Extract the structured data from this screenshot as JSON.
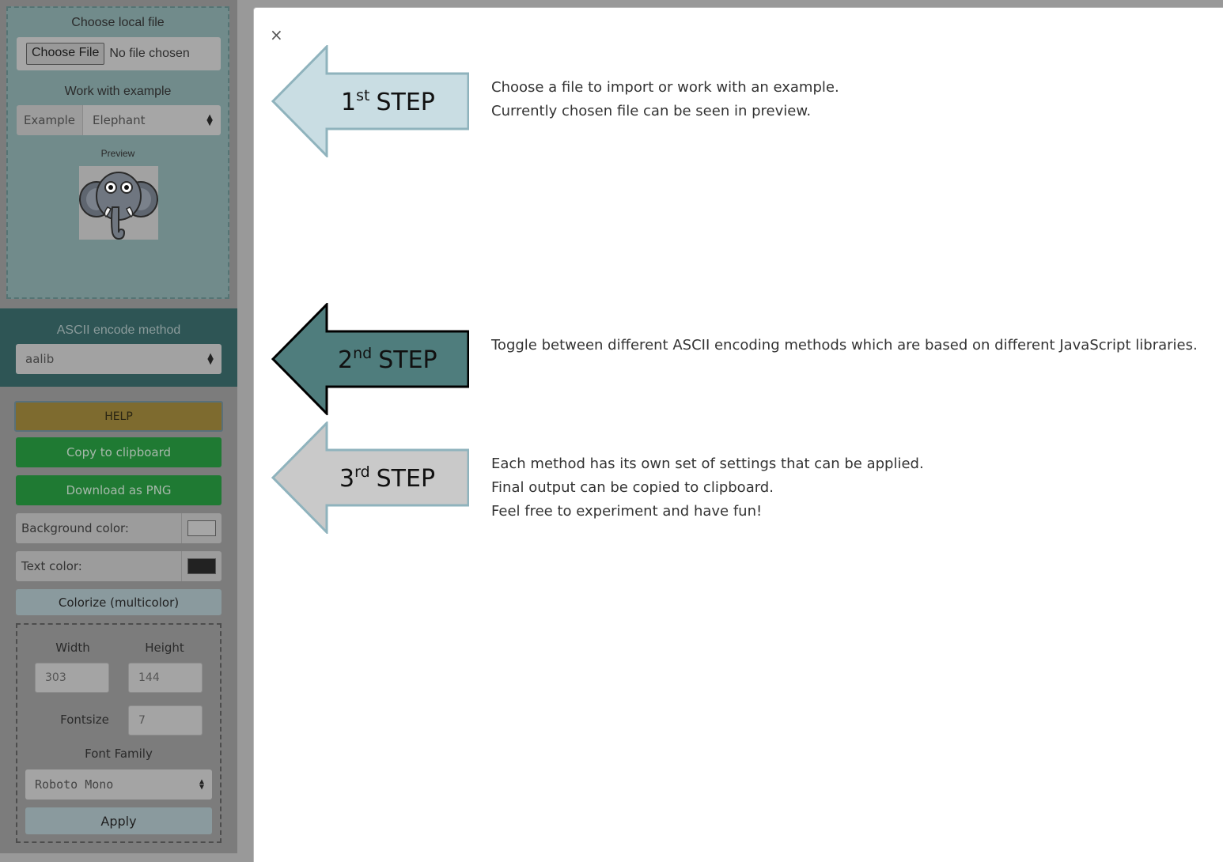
{
  "sidebar": {
    "file_section": {
      "choose_local_label": "Choose local file",
      "choose_button": "Choose File",
      "no_file_text": "No file chosen",
      "work_example_label": "Work with example",
      "example_addon": "Example",
      "example_value": "Elephant",
      "preview_label": "Preview"
    },
    "encode": {
      "label": "ASCII encode method",
      "value": "aalib"
    },
    "buttons": {
      "help": "HELP",
      "copy": "Copy to clipboard",
      "download": "Download as PNG",
      "colorize": "Colorize (multicolor)"
    },
    "colors": {
      "background_label": "Background color:",
      "background_value": "#a6a6a6",
      "text_label": "Text color:",
      "text_value": "#222222"
    },
    "settings": {
      "width_label": "Width",
      "width_value": "303",
      "height_label": "Height",
      "height_value": "144",
      "fontsize_label": "Fontsize",
      "fontsize_value": "7",
      "font_family_label": "Font Family",
      "font_family_value": "Roboto Mono",
      "apply": "Apply"
    }
  },
  "modal": {
    "close": "×",
    "steps": [
      {
        "number": "1",
        "suffix": "st",
        "word": "STEP",
        "color": "#c9dde3",
        "stroke": "#8fb3bd",
        "lines": [
          "Choose a file to import or work with an example.",
          "Currently chosen file can be seen in preview."
        ]
      },
      {
        "number": "2",
        "suffix": "nd",
        "word": "STEP",
        "color": "#4f7d7d",
        "stroke": "#000000",
        "lines": [
          "Toggle between different ASCII encoding methods which are based on different JavaScript libraries."
        ]
      },
      {
        "number": "3",
        "suffix": "rd",
        "word": "STEP",
        "color": "#c9c9c9",
        "stroke": "#8fb3bd",
        "lines": [
          "Each method has its own set of settings that can be applied.",
          "Final output can be copied to clipboard.",
          "Feel free to experiment and have fun!"
        ]
      }
    ]
  }
}
